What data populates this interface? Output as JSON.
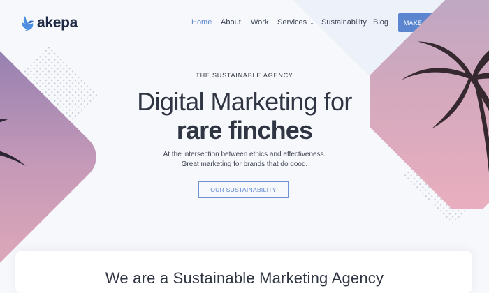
{
  "header": {
    "logo_text": "akepa",
    "nav": [
      {
        "label": "Home",
        "active": true
      },
      {
        "label": "About",
        "active": false
      },
      {
        "label": "Work",
        "active": false
      },
      {
        "label": "Services",
        "active": false,
        "dropdown": true
      },
      {
        "label": "Sustainability",
        "active": false
      },
      {
        "label": "Blog",
        "active": false
      }
    ],
    "cta_label": "MAKE AN ENQUIRY"
  },
  "hero": {
    "eyebrow": "THE SUSTAINABLE AGENCY",
    "headline_line1": "Digital Marketing for",
    "headline_line2": "rare finches",
    "subtext_line1": "At the intersection between ethics and effectiveness.",
    "subtext_line2": "Great marketing for brands that do good.",
    "button_label": "OUR SUSTAINABILITY"
  },
  "section": {
    "title": "We are a Sustainable Marketing Agency"
  },
  "colors": {
    "accent": "#5b86cf",
    "text_dark": "#2f3542",
    "background": "#f7f8fb"
  },
  "icons": {
    "logo": "bird-logo-icon",
    "services_dropdown": "chevron-down-icon"
  }
}
